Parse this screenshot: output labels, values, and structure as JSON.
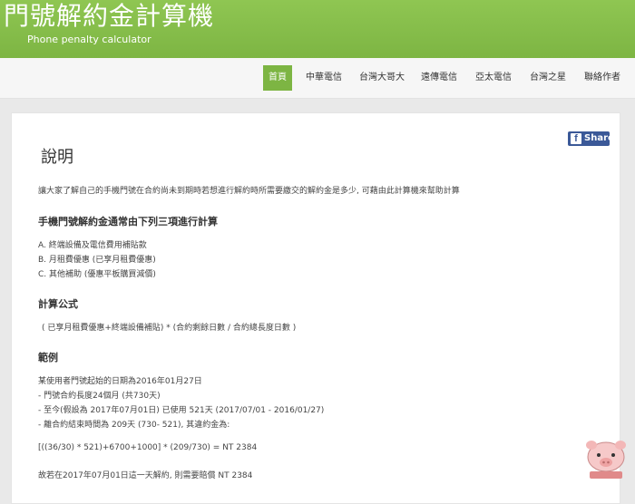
{
  "header": {
    "title": "門號解約金計算機",
    "subtitle": "Phone penalty calculator"
  },
  "nav": {
    "items": [
      {
        "label": "首頁",
        "active": true
      },
      {
        "label": "中華電信"
      },
      {
        "label": "台灣大哥大"
      },
      {
        "label": "遠傳電信"
      },
      {
        "label": "亞太電信"
      },
      {
        "label": "台灣之星"
      },
      {
        "label": "聯絡作者"
      }
    ]
  },
  "share": {
    "label": "Share",
    "icon": "facebook-icon"
  },
  "content": {
    "title": "說明",
    "intro": "讓大家了解自己的手機門號在合約尚未到期時若想進行解約時所需要繳交的解約金是多少, 可藉由此計算機來幫助計算",
    "section1": {
      "heading": "手機門號解約金通常由下列三項進行計算",
      "items": [
        "A. 終端設備及電信費用補貼款",
        "B. 月租費優惠 (已享月租費優惠)",
        "C. 其他補助 (優惠平板購買減價)"
      ]
    },
    "section2": {
      "heading": "計算公式",
      "formula": "( 已享月租費優惠+終端設備補貼) * (合約剩餘日數 / 合約總長度日數 )"
    },
    "section3": {
      "heading": "範例",
      "lines": [
        "某使用者門號起始的日期為2016年01月27日",
        "- 門號合約長度24個月 (共730天)",
        "- 至今(假設為 2017年07月01日) 已使用 521天 (2017/07/01 - 2016/01/27)",
        "- 離合約結束時間為 209天 (730- 521), 其違約金為:"
      ],
      "calc": "[((36/30) * 521)+6700+1000] * (209/730) = NT 2384",
      "conclusion": "故若在2017年07月01日這一天解約, 則需要賠償 NT 2384"
    }
  },
  "colors": {
    "header_green": "#7db543",
    "facebook_blue": "#3b5998"
  }
}
